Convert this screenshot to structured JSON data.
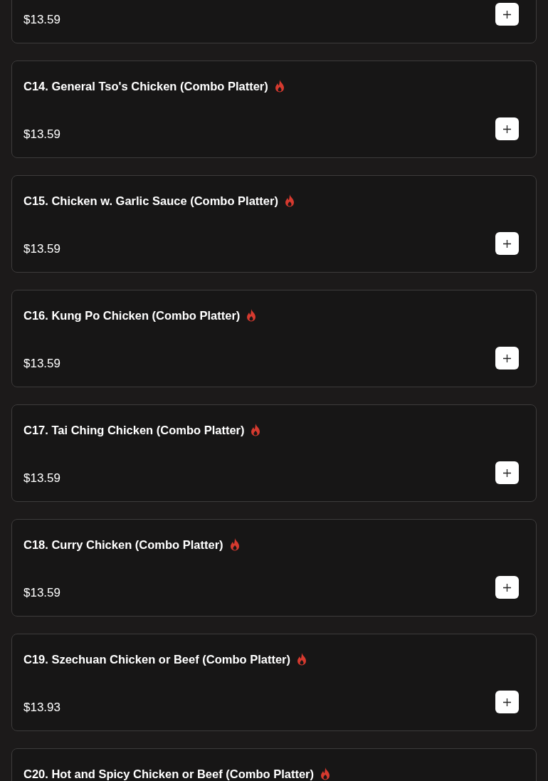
{
  "menu_items": [
    {
      "price": "$13.59"
    },
    {
      "title": "C14. General Tso's Chicken (Combo Platter)",
      "spicy": true,
      "price": "$13.59"
    },
    {
      "title": "C15. Chicken w. Garlic Sauce (Combo Platter)",
      "spicy": true,
      "price": "$13.59"
    },
    {
      "title": "C16. Kung Po Chicken (Combo Platter)",
      "spicy": true,
      "price": "$13.59"
    },
    {
      "title": "C17. Tai Ching Chicken (Combo Platter)",
      "spicy": true,
      "price": "$13.59"
    },
    {
      "title": "C18. Curry Chicken (Combo Platter)",
      "spicy": true,
      "price": "$13.59"
    },
    {
      "title": "C19. Szechuan Chicken or Beef (Combo Platter)",
      "spicy": true,
      "price": "$13.93"
    },
    {
      "title": "C20. Hot and Spicy Chicken or Beef (Combo Platter)",
      "spicy": true
    }
  ]
}
